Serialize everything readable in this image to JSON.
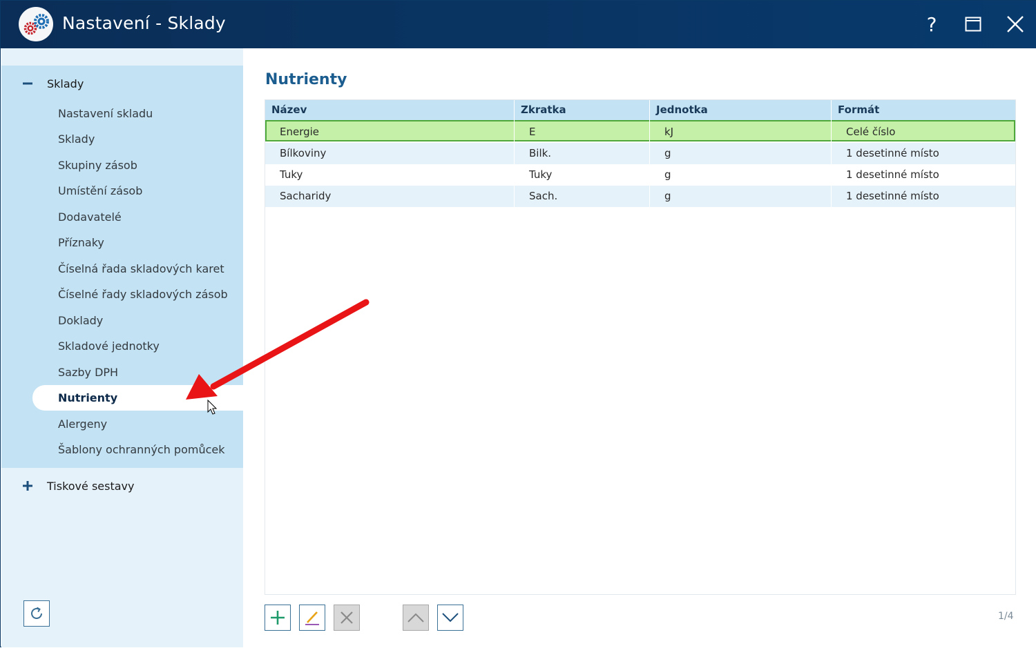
{
  "window": {
    "title": "Nastavení - Sklady",
    "help_label": "?"
  },
  "sidebar": {
    "groups": [
      {
        "label": "Sklady",
        "expanded": true,
        "items": [
          {
            "label": "Nastavení skladu"
          },
          {
            "label": "Sklady"
          },
          {
            "label": "Skupiny zásob"
          },
          {
            "label": "Umístění zásob"
          },
          {
            "label": "Dodavatelé"
          },
          {
            "label": "Příznaky"
          },
          {
            "label": "Číselná řada skladových karet"
          },
          {
            "label": "Číselné řady skladových zásob"
          },
          {
            "label": "Doklady"
          },
          {
            "label": "Skladové jednotky"
          },
          {
            "label": "Sazby DPH"
          },
          {
            "label": "Nutrienty",
            "active": true
          },
          {
            "label": "Alergeny"
          },
          {
            "label": "Šablony ochranných pomůcek"
          }
        ]
      },
      {
        "label": "Tiskové sestavy",
        "expanded": false
      }
    ]
  },
  "main": {
    "title": "Nutrienty",
    "columns": [
      "Název",
      "Zkratka",
      "Jednotka",
      "Formát"
    ],
    "rows": [
      {
        "nazev": "Energie",
        "zkratka": "E",
        "jednotka": "kJ",
        "format": "Celé číslo",
        "selected": true
      },
      {
        "nazev": "Bílkoviny",
        "zkratka": "Bilk.",
        "jednotka": "g",
        "format": "1 desetinné místo"
      },
      {
        "nazev": "Tuky",
        "zkratka": "Tuky",
        "jednotka": "g",
        "format": "1 desetinné místo"
      },
      {
        "nazev": "Sacharidy",
        "zkratka": "Sach.",
        "jednotka": "g",
        "format": "1 desetinné místo"
      }
    ],
    "pager": "1/4"
  },
  "toolbar": {
    "icons": [
      "plus-icon",
      "pencil-icon",
      "x-icon",
      "chevron-up-icon",
      "chevron-down-icon"
    ]
  },
  "colors": {
    "titlebar": "#0a2e57",
    "sidebar_group": "#c3e2f3",
    "selected_row": "#c4f0a7",
    "selected_border": "#4ea83a",
    "accent_title": "#1c5d8f",
    "annotation_arrow": "#e81416"
  }
}
